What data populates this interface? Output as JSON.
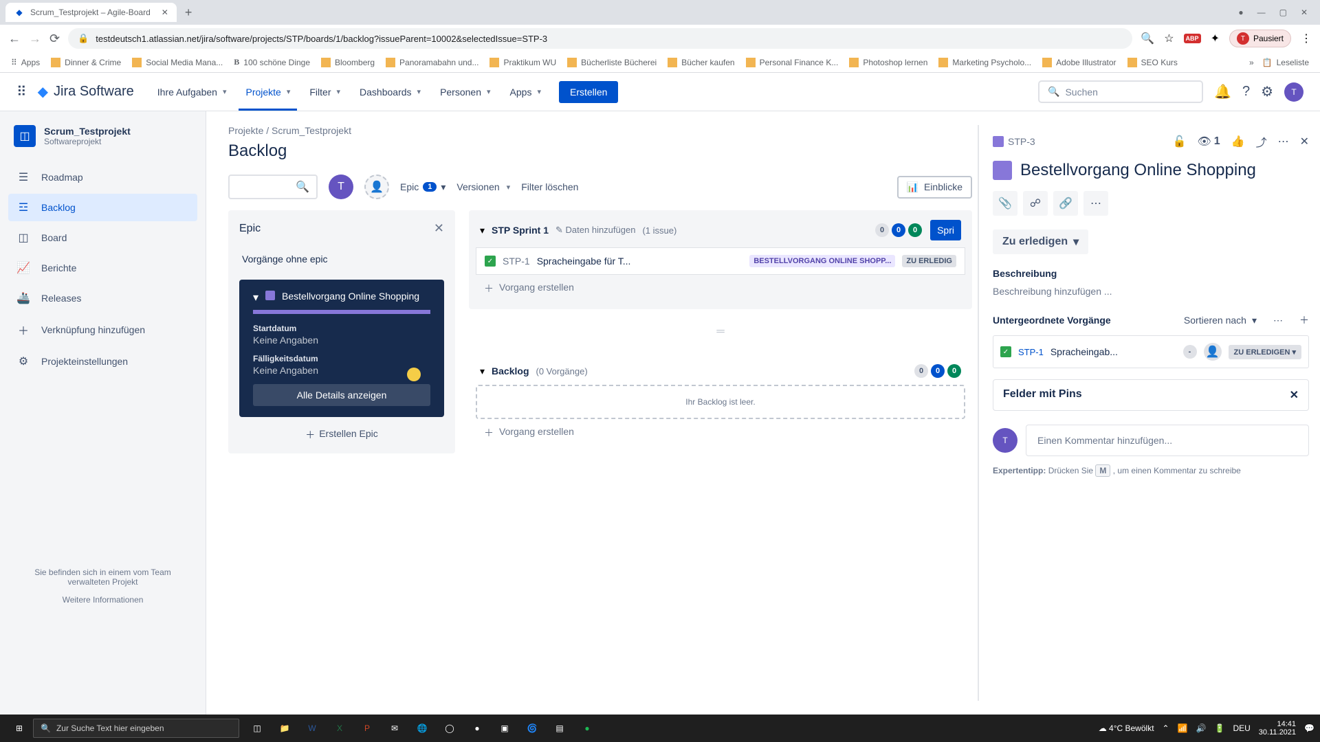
{
  "browser": {
    "tab_title": "Scrum_Testprojekt – Agile-Board",
    "url": "testdeutsch1.atlassian.net/jira/software/projects/STP/boards/1/backlog?issueParent=10002&selectedIssue=STP-3",
    "paused": "Pausiert",
    "bookmarks": [
      "Apps",
      "Dinner & Crime",
      "Social Media Mana...",
      "100 schöne Dinge",
      "Bloomberg",
      "Panoramabahn und...",
      "Praktikum WU",
      "Bücherliste Bücherei",
      "Bücher kaufen",
      "Personal Finance K...",
      "Photoshop lernen",
      "Marketing Psycholo...",
      "Adobe Illustrator",
      "SEO Kurs"
    ],
    "reading_list": "Leseliste"
  },
  "nav": {
    "product": "Jira Software",
    "items": [
      "Ihre Aufgaben",
      "Projekte",
      "Filter",
      "Dashboards",
      "Personen",
      "Apps"
    ],
    "create": "Erstellen",
    "search_placeholder": "Suchen"
  },
  "sidebar": {
    "project_name": "Scrum_Testprojekt",
    "project_type": "Softwareprojekt",
    "links": [
      "Roadmap",
      "Backlog",
      "Board",
      "Berichte",
      "Releases",
      "Verknüpfung hinzufügen",
      "Projekteinstellungen"
    ],
    "footer_text": "Sie befinden sich in einem vom Team verwalteten Projekt",
    "footer_link": "Weitere Informationen"
  },
  "breadcrumb": {
    "root": "Projekte",
    "project": "Scrum_Testprojekt"
  },
  "page_title": "Backlog",
  "filters": {
    "epic_label": "Epic",
    "epic_count": "1",
    "versions": "Versionen",
    "clear": "Filter löschen",
    "insights": "Einblicke"
  },
  "epic_panel": {
    "title": "Epic",
    "no_epic": "Vorgänge ohne epic",
    "name": "Bestellvorgang Online Shopping",
    "start_label": "Startdatum",
    "start_value": "Keine Angaben",
    "due_label": "Fälligkeitsdatum",
    "due_value": "Keine Angaben",
    "details_btn": "Alle Details anzeigen",
    "create_epic": "Erstellen Epic"
  },
  "sprint": {
    "name": "STP Sprint 1",
    "add_data": "Daten hinzufügen",
    "count_text": "(1 issue)",
    "counters": [
      "0",
      "0",
      "0"
    ],
    "start_btn": "Spri",
    "issue": {
      "key": "STP-1",
      "summary": "Spracheingabe für T...",
      "epic": "BESTELLVORGANG ONLINE SHOPP...",
      "status": "ZU ERLEDIG"
    },
    "create_issue": "Vorgang erstellen"
  },
  "backlog": {
    "name": "Backlog",
    "count_text": "(0 Vorgänge)",
    "counters": [
      "0",
      "0",
      "0"
    ],
    "empty": "Ihr Backlog ist leer.",
    "create_issue": "Vorgang erstellen"
  },
  "detail": {
    "key": "STP-3",
    "watchers": "1",
    "title": "Bestellvorgang Online Shopping",
    "status": "Zu erledigen",
    "desc_title": "Beschreibung",
    "desc_placeholder": "Beschreibung hinzufügen ...",
    "child_title": "Untergeordnete Vorgänge",
    "sort": "Sortieren nach",
    "child": {
      "key": "STP-1",
      "summary": "Spracheingab...",
      "estimate": "-",
      "status": "ZU ERLEDIGEN"
    },
    "pins_title": "Felder mit Pins",
    "comment_placeholder": "Einen Kommentar hinzufügen...",
    "tip_label": "Expertentipp:",
    "tip_text1": "Drücken Sie",
    "tip_key": "M",
    "tip_text2": ", um einen Kommentar zu schreibe"
  },
  "taskbar": {
    "search_placeholder": "Zur Suche Text hier eingeben",
    "weather": "4°C Bewölkt",
    "lang": "DEU",
    "time": "14:41",
    "date": "30.11.2021"
  }
}
